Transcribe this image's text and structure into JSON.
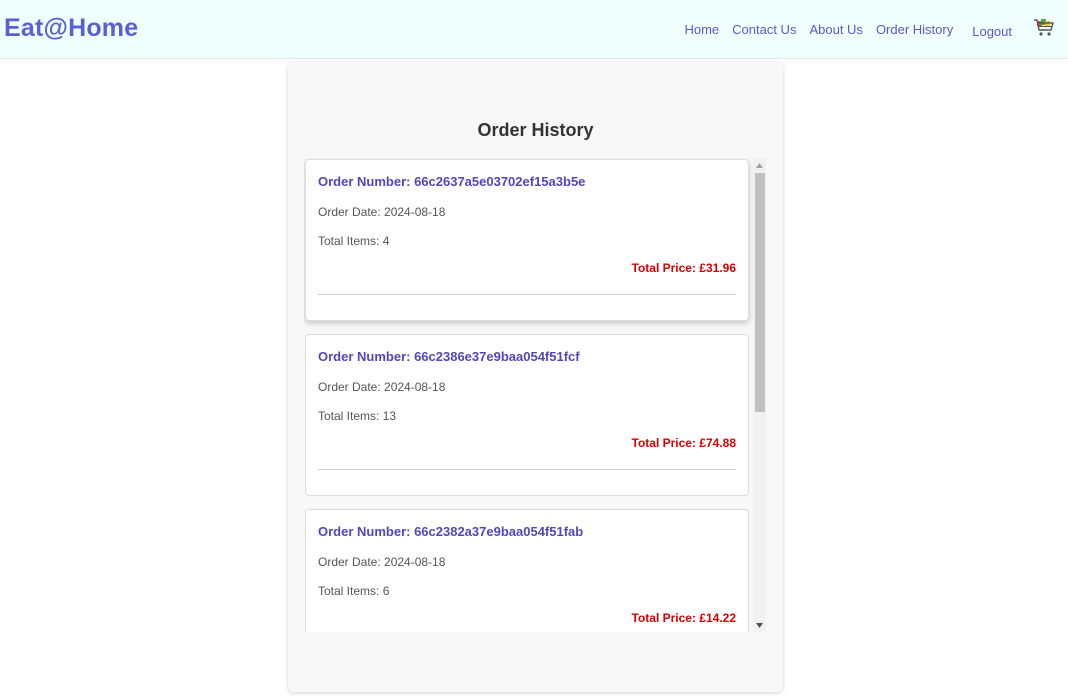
{
  "navbar": {
    "brand": "Eat@Home",
    "links": {
      "home": "Home",
      "contact": "Contact Us",
      "about": "About Us",
      "history": "Order History",
      "logout": "Logout"
    },
    "cart_icon": "shopping-cart-icon",
    "background_color": "#f0fffe",
    "brand_color": "#5b5fd6"
  },
  "page": {
    "title": "Order History"
  },
  "orders": [
    {
      "number": "Order Number: 66c2637a5e03702ef15a3b5e",
      "date": "Order Date: 2024-08-18",
      "items": "Total Items: 4",
      "price": "Total Price: £31.96"
    },
    {
      "number": "Order Number: 66c2386e37e9baa054f51fcf",
      "date": "Order Date: 2024-08-18",
      "items": "Total Items: 13",
      "price": "Total Price: £74.88"
    },
    {
      "number": "Order Number: 66c2382a37e9baa054f51fab",
      "date": "Order Date: 2024-08-18",
      "items": "Total Items: 6",
      "price": "Total Price: £14.22"
    }
  ],
  "colors": {
    "order_number": "#5346b8",
    "price": "#d80000"
  }
}
